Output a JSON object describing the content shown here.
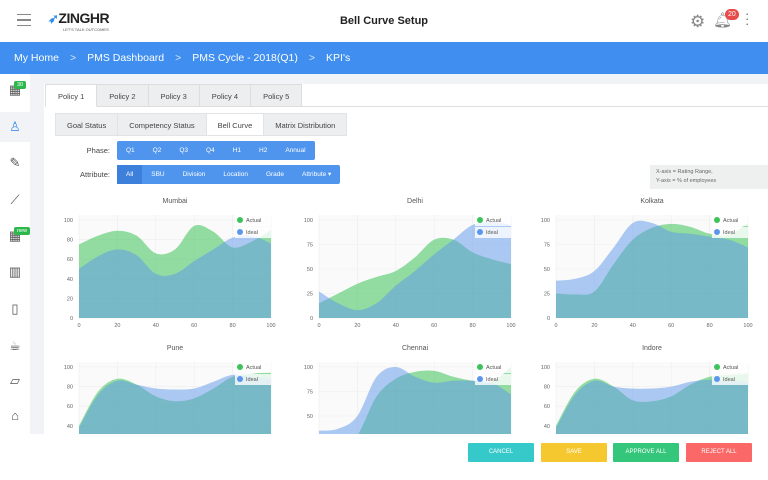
{
  "header": {
    "title": "Bell Curve Setup",
    "logo": "ZINGHR",
    "logo_tagline": "LET'S TALK OUTCOMES",
    "notifications": "20"
  },
  "breadcrumb": [
    "My Home",
    "PMS Dashboard",
    "PMS Cycle - 2018(Q1)",
    "KPI's"
  ],
  "sidebar": {
    "badges": {
      "first": "30",
      "fifth": "new"
    },
    "icons": [
      "apps-icon",
      "person-icon",
      "edit-icon",
      "trend-icon",
      "widgets-icon",
      "map-icon",
      "document-icon",
      "coffee-icon",
      "folder-icon",
      "graduation-icon"
    ]
  },
  "policy_tabs": [
    "Policy 1",
    "Policy 2",
    "Policy 3",
    "Policy 4",
    "Policy 5"
  ],
  "inner_tabs": [
    "Goal Status",
    "Competency Status",
    "Bell Curve",
    "Matrix Distribution"
  ],
  "phase": {
    "label": "Phase:",
    "options": [
      "Q1",
      "Q2",
      "Q3",
      "Q4",
      "H1",
      "H2",
      "Annual"
    ]
  },
  "attribute": {
    "label": "Attribute:",
    "options": [
      "All",
      "SBU",
      "Division",
      "Location",
      "Grade",
      "Attribute ▾"
    ]
  },
  "note": {
    "line1": "X-axis = Rating Range,",
    "line2": "Y-axis = % of employees"
  },
  "colors": {
    "actual": "#3cc35a",
    "ideal": "#5b96ea",
    "brand": "#3f8ef0"
  },
  "chart_data": [
    {
      "type": "area",
      "title": "Mumbai",
      "legend": [
        "Actual",
        "Ideal"
      ],
      "xlim": [
        0,
        100
      ],
      "ylim": [
        0,
        100
      ],
      "xticks": [
        0,
        20,
        40,
        60,
        80,
        100
      ],
      "yticks": [
        0,
        20,
        40,
        60,
        80,
        100
      ],
      "x": [
        0,
        10,
        20,
        30,
        40,
        50,
        60,
        70,
        80,
        90,
        100
      ],
      "series": [
        {
          "name": "Actual",
          "values": [
            75,
            84,
            89,
            84,
            66,
            70,
            94,
            88,
            72,
            78,
            90
          ]
        },
        {
          "name": "Ideal",
          "values": [
            50,
            63,
            70,
            64,
            45,
            45,
            58,
            70,
            82,
            84,
            76
          ]
        }
      ]
    },
    {
      "type": "area",
      "title": "Delhi",
      "legend": [
        "Actual",
        "Ideal"
      ],
      "xlim": [
        0,
        100
      ],
      "ylim": [
        0,
        100
      ],
      "xticks": [
        0,
        20,
        40,
        60,
        80,
        100
      ],
      "yticks": [
        0,
        25,
        50,
        75,
        100
      ],
      "x": [
        0,
        10,
        20,
        30,
        40,
        50,
        60,
        70,
        80,
        90,
        100
      ],
      "series": [
        {
          "name": "Actual",
          "values": [
            15,
            25,
            35,
            42,
            48,
            62,
            80,
            80,
            67,
            60,
            55
          ]
        },
        {
          "name": "Ideal",
          "values": [
            27,
            15,
            8,
            15,
            33,
            48,
            65,
            80,
            95,
            98,
            95
          ]
        }
      ]
    },
    {
      "type": "area",
      "title": "Kolkata",
      "legend": [
        "Actual",
        "Ideal"
      ],
      "xlim": [
        0,
        100
      ],
      "ylim": [
        0,
        100
      ],
      "xticks": [
        0,
        20,
        40,
        60,
        80,
        100
      ],
      "yticks": [
        0,
        25,
        50,
        75,
        100
      ],
      "x": [
        0,
        10,
        20,
        30,
        40,
        50,
        60,
        70,
        80,
        90,
        100
      ],
      "series": [
        {
          "name": "Actual",
          "values": [
            25,
            24,
            27,
            55,
            80,
            92,
            96,
            93,
            86,
            85,
            97
          ]
        },
        {
          "name": "Ideal",
          "values": [
            38,
            40,
            48,
            72,
            97,
            97,
            88,
            86,
            83,
            80,
            72
          ]
        }
      ]
    },
    {
      "type": "area",
      "title": "Pune",
      "legend": [
        "Actual",
        "Ideal"
      ],
      "xlim": [
        0,
        100
      ],
      "ylim": [
        0,
        100
      ],
      "xticks": [],
      "yticks": [
        40,
        60,
        80,
        100
      ],
      "x": [
        0,
        10,
        20,
        30,
        40,
        50,
        60,
        70,
        80,
        90,
        100
      ],
      "series": [
        {
          "name": "Actual",
          "values": [
            40,
            75,
            88,
            82,
            70,
            65,
            68,
            78,
            90,
            93,
            95
          ]
        },
        {
          "name": "Ideal",
          "values": [
            38,
            72,
            86,
            82,
            78,
            77,
            78,
            85,
            92,
            90,
            88
          ]
        }
      ]
    },
    {
      "type": "area",
      "title": "Chennai",
      "legend": [
        "Actual",
        "Ideal"
      ],
      "xlim": [
        0,
        100
      ],
      "ylim": [
        0,
        100
      ],
      "xticks": [],
      "yticks": [
        50,
        75,
        100
      ],
      "x": [
        0,
        10,
        20,
        30,
        40,
        50,
        60,
        70,
        80,
        90,
        100
      ],
      "series": [
        {
          "name": "Actual",
          "values": [
            0,
            10,
            30,
            70,
            88,
            95,
            96,
            90,
            86,
            85,
            100
          ]
        },
        {
          "name": "Ideal",
          "values": [
            35,
            37,
            50,
            90,
            100,
            90,
            84,
            86,
            86,
            84,
            72
          ]
        }
      ]
    },
    {
      "type": "area",
      "title": "Indore",
      "legend": [
        "Actual",
        "Ideal"
      ],
      "xlim": [
        0,
        100
      ],
      "ylim": [
        0,
        100
      ],
      "xticks": [],
      "yticks": [
        40,
        60,
        80,
        100
      ],
      "x": [
        0,
        10,
        20,
        30,
        40,
        50,
        60,
        70,
        80,
        90,
        100
      ],
      "series": [
        {
          "name": "Actual",
          "values": [
            40,
            75,
            88,
            80,
            66,
            65,
            70,
            82,
            90,
            92,
            93
          ]
        },
        {
          "name": "Ideal",
          "values": [
            38,
            72,
            86,
            80,
            78,
            78,
            80,
            85,
            87,
            86,
            85
          ]
        }
      ]
    }
  ],
  "footer": {
    "cancel": "CANCEL",
    "save": "SAVE",
    "approve": "APPROVE ALL",
    "reject": "REJECT ALL"
  }
}
